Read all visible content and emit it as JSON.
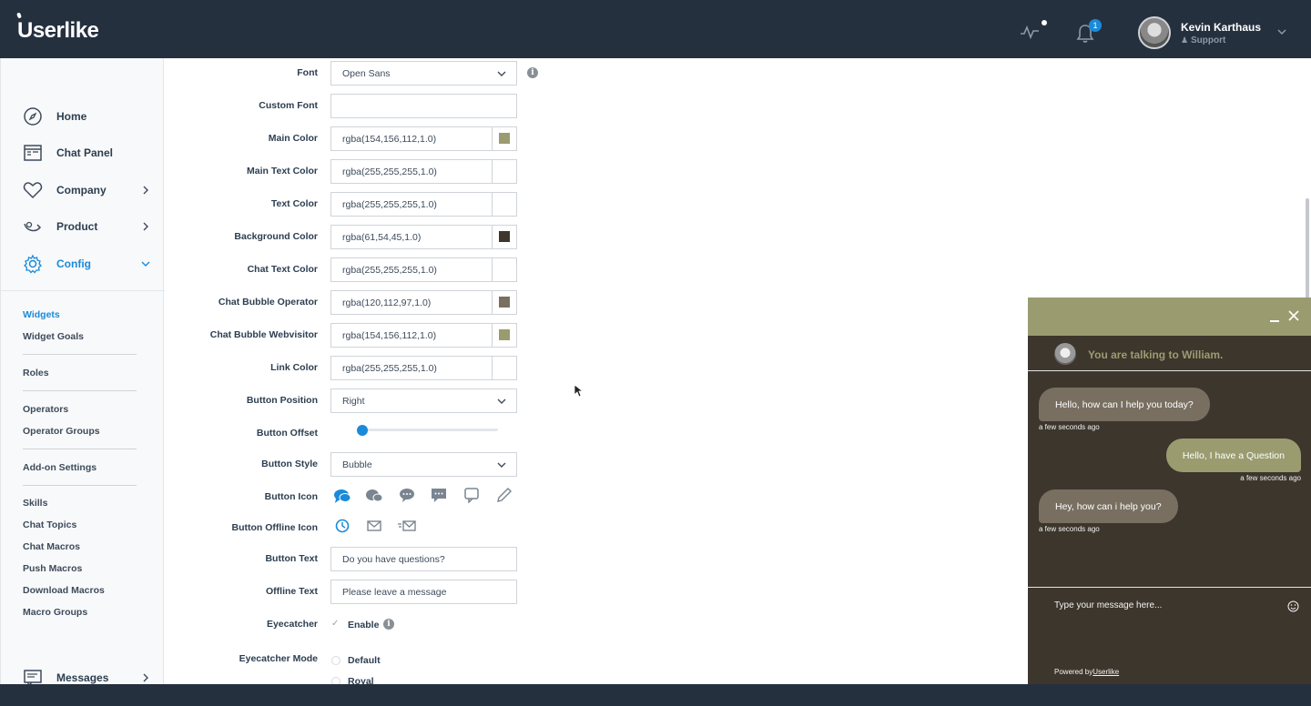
{
  "header": {
    "logo": "Userlike",
    "notification_count": "1",
    "user_name": "Kevin Karthaus",
    "user_role": "Support"
  },
  "sidebar": {
    "nav": [
      {
        "label": "Home",
        "icon": "compass-icon"
      },
      {
        "label": "Chat Panel",
        "icon": "chat-panel-icon"
      },
      {
        "label": "Company",
        "icon": "heart-icon"
      },
      {
        "label": "Product",
        "icon": "product-icon"
      },
      {
        "label": "Config",
        "icon": "gear-icon"
      }
    ],
    "sub_items": [
      "Widgets",
      "Widget Goals",
      "Roles",
      "Operators",
      "Operator Groups",
      "Add-on Settings",
      "Skills",
      "Chat Topics",
      "Chat Macros",
      "Push Macros",
      "Download Macros",
      "Macro Groups"
    ],
    "messages": "Messages"
  },
  "form": {
    "font": {
      "label": "Font",
      "value": "Open Sans"
    },
    "custom_font": {
      "label": "Custom Font",
      "value": ""
    },
    "colors": [
      {
        "label": "Main Color",
        "value": "rgba(154,156,112,1.0)",
        "swatch": "#9a9c70"
      },
      {
        "label": "Main Text Color",
        "value": "rgba(255,255,255,1.0)",
        "swatch": "#ffffff"
      },
      {
        "label": "Text Color",
        "value": "rgba(255,255,255,1.0)",
        "swatch": "#ffffff"
      },
      {
        "label": "Background Color",
        "value": "rgba(61,54,45,1.0)",
        "swatch": "#3d362d"
      },
      {
        "label": "Chat Text Color",
        "value": "rgba(255,255,255,1.0)",
        "swatch": "#ffffff"
      },
      {
        "label": "Chat Bubble Operator",
        "value": "rgba(120,112,97,1.0)",
        "swatch": "#786f61"
      },
      {
        "label": "Chat Bubble Webvisitor",
        "value": "rgba(154,156,112,1.0)",
        "swatch": "#9a9c70"
      },
      {
        "label": "Link Color",
        "value": "rgba(255,255,255,1.0)",
        "swatch": "#ffffff"
      }
    ],
    "button_position": {
      "label": "Button Position",
      "value": "Right"
    },
    "button_offset": {
      "label": "Button Offset",
      "fraction": 0.0
    },
    "button_style": {
      "label": "Button Style",
      "value": "Bubble"
    },
    "button_icon": {
      "label": "Button Icon"
    },
    "button_offline_icon": {
      "label": "Button Offline Icon"
    },
    "button_text": {
      "label": "Button Text",
      "value": "Do you have questions?"
    },
    "offline_text": {
      "label": "Offline Text",
      "value": "Please leave a message"
    },
    "eyecatcher": {
      "label": "Eyecatcher",
      "option": "Enable"
    },
    "eyecatcher_mode": {
      "label": "Eyecatcher Mode",
      "options": [
        "Default",
        "Royal"
      ]
    }
  },
  "chat": {
    "operator_text": "You are talking to William.",
    "messages": [
      {
        "from": "operator",
        "text": "Hello, how can I help you today?",
        "time": "a few seconds ago"
      },
      {
        "from": "visitor",
        "text": "Hello, I have a Question",
        "time": "a few seconds ago"
      },
      {
        "from": "operator",
        "text": "Hey, how can i help you?",
        "time": "a few seconds ago"
      }
    ],
    "input_placeholder": "Type your message here...",
    "powered_by": "Powered by",
    "powered_link": "Userlike"
  },
  "colors": {
    "accent": "#1a8ad9",
    "topbar": "#25303f"
  }
}
